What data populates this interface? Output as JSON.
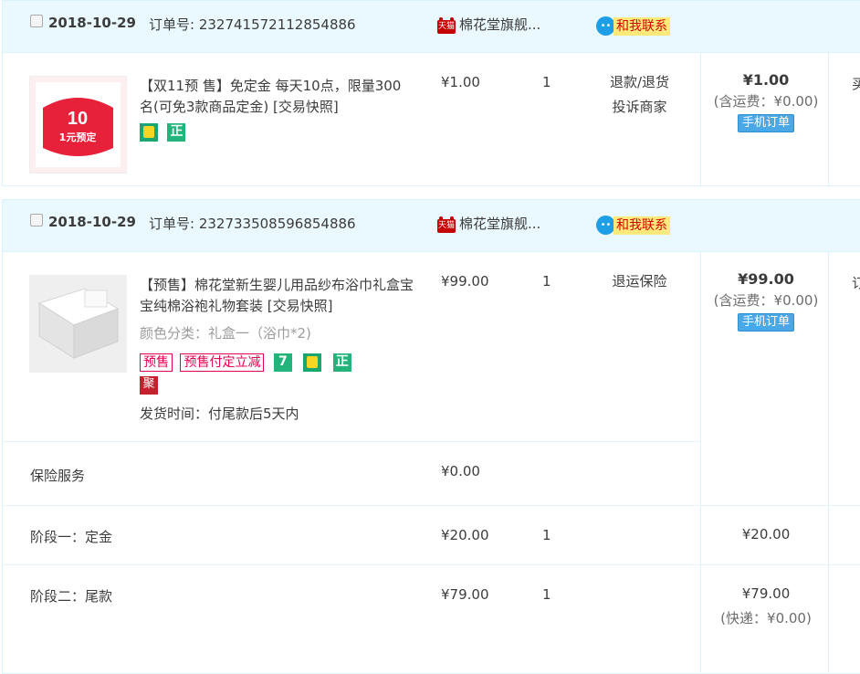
{
  "orders": [
    {
      "date": "2018-10-29",
      "order_no_label": "订单号: 232741572112854886",
      "tmall_icon_text": "天猫",
      "shop_name": "棉花堂旗舰...",
      "contact_label": "和我联系",
      "item": {
        "thumb_text": "1元预定",
        "thumb_big": "10",
        "title": "【双11预 售】免定金 每天10点，限量300名(可免3款商品定金) [交易快照]",
        "price": "¥1.00",
        "qty": "1",
        "service_1": "退款/退货",
        "service_2": "投诉商家",
        "total": "¥1.00",
        "shipping": "(含运费：¥0.00)",
        "mobile_label": "手机订单",
        "tags": [
          "正"
        ],
        "edge": "买"
      }
    },
    {
      "date": "2018-10-29",
      "order_no_label": "订单号: 232733508596854886",
      "tmall_icon_text": "天猫",
      "shop_name": "棉花堂旗舰...",
      "contact_label": "和我联系",
      "item": {
        "title": "【预售】棉花堂新生婴儿用品纱布浴巾礼盒宝宝纯棉浴袍礼物套装 [交易快照]",
        "sku": "颜色分类：礼盒一（浴巾*2)",
        "price": "¥99.00",
        "qty": "1",
        "service_1": "退运保险",
        "total": "¥99.00",
        "shipping": "(含运费：¥0.00)",
        "mobile_label": "手机订单",
        "tag_presale": "预售",
        "tag_presale_discount": "预售付定立减",
        "tag_seven": "7",
        "tag_zheng": "正",
        "tag_ju": "聚",
        "delivery": "发货时间：付尾款后5天内",
        "edge": "订"
      },
      "insurance": {
        "label": "保险服务",
        "price": "¥0.00"
      },
      "stage1": {
        "label": "阶段一：定金",
        "price": "¥20.00",
        "qty": "1",
        "total": "¥20.00"
      },
      "stage2": {
        "label": "阶段二：尾款",
        "price": "¥79.00",
        "qty": "1",
        "total": "¥79.00",
        "shipping": "(快递：¥0.00)"
      }
    }
  ]
}
